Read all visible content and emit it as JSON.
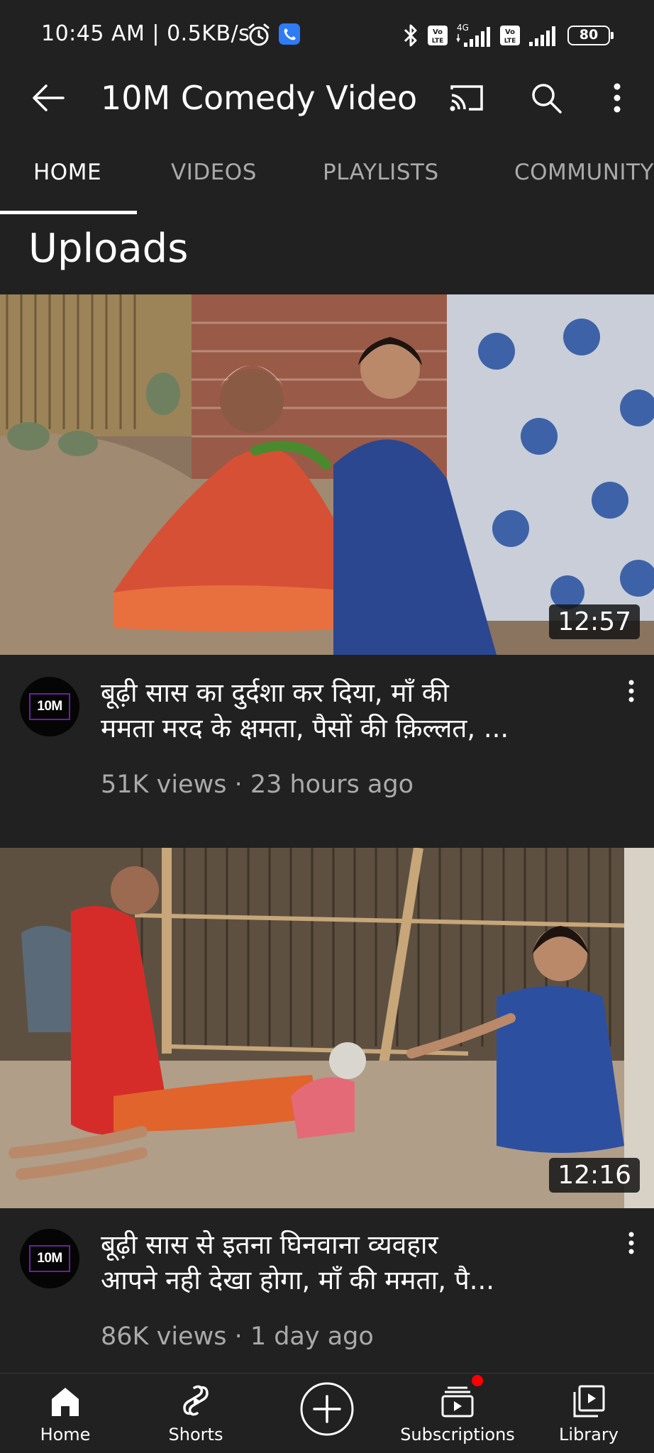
{
  "status_bar": {
    "time_speed": "10:45 AM | 0.5KB/s",
    "network": "4G",
    "volte_1": "Vo\nLTE",
    "volte_2": "Vo\nLTE",
    "battery": "80",
    "icons": [
      "alarm-icon",
      "call-icon",
      "bluetooth-icon",
      "volte-icon",
      "signal-icon",
      "battery-icon"
    ]
  },
  "header": {
    "channel_title": "10M  Comedy Video",
    "icons": [
      "back-arrow-icon",
      "cast-icon",
      "search-icon",
      "more-vert-icon"
    ]
  },
  "tabs": [
    {
      "label": "HOME",
      "active": true
    },
    {
      "label": "VIDEOS",
      "active": false
    },
    {
      "label": "PLAYLISTS",
      "active": false
    },
    {
      "label": "COMMUNITY",
      "active": false
    }
  ],
  "section_title": "Uploads",
  "videos": [
    {
      "duration": "12:57",
      "avatar_text": "10M",
      "title_line1": "बूढ़ी सास का दुर्दशा कर दिया, माँ की",
      "title_line2": "ममता मरद के क्षमता, पैसों की क़िल्लत, ...",
      "meta": "51K views · 23 hours ago"
    },
    {
      "duration": "12:16",
      "avatar_text": "10M",
      "title_line1": "बूढ़ी सास से इतना घिनवाना व्यवहार",
      "title_line2": "आपने नही देखा होगा, माँ की ममता, पै...",
      "meta": "86K views · 1 day ago"
    }
  ],
  "bottom_nav": [
    {
      "label": "Home",
      "icon": "home-icon",
      "active": true
    },
    {
      "label": "Shorts",
      "icon": "shorts-icon",
      "active": false
    },
    {
      "label": "",
      "icon": "create-plus-icon",
      "active": false
    },
    {
      "label": "Subscriptions",
      "icon": "subscriptions-icon",
      "active": false,
      "badge": true
    },
    {
      "label": "Library",
      "icon": "library-icon",
      "active": false
    }
  ],
  "colors": {
    "background": "#212121",
    "secondary_text": "#aaaaaa",
    "badge": "#ff0000"
  }
}
